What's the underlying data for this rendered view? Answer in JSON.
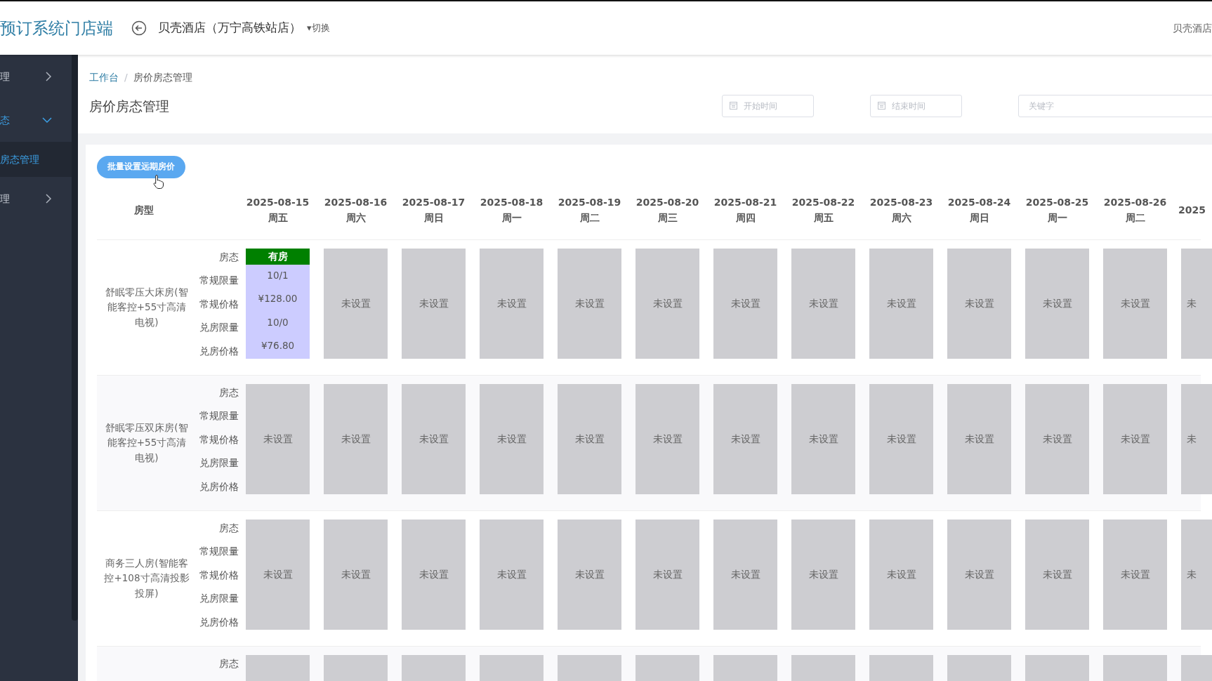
{
  "topbar": {
    "app_title": "预订系统门店端",
    "hotel_name": "贝壳酒店（万宁高铁站店）",
    "switch_label": "▾切换",
    "user": "贝壳酒店"
  },
  "sidebar": {
    "items": [
      {
        "label": "理",
        "expanded": false
      },
      {
        "label": "态",
        "expanded": true,
        "children": [
          {
            "label": "房态管理",
            "selected": true
          }
        ]
      },
      {
        "label": "理",
        "expanded": false
      }
    ]
  },
  "breadcrumb": [
    {
      "label": "工作台",
      "kind": "link"
    },
    {
      "label": "/",
      "kind": "separator"
    },
    {
      "label": "房价房态管理",
      "kind": "current"
    }
  ],
  "page_title": "房价房态管理",
  "filters": [
    {
      "placeholder": "开始时间",
      "kind": "date"
    },
    {
      "placeholder": "结束时间",
      "kind": "date"
    },
    {
      "placeholder": "关键字",
      "kind": "text"
    }
  ],
  "batch_button": "批量设置远期房价",
  "table": {
    "room_header": "房型",
    "dates": [
      {
        "date": "2025-08-15",
        "weekday": "周五"
      },
      {
        "date": "2025-08-16",
        "weekday": "周六"
      },
      {
        "date": "2025-08-17",
        "weekday": "周日"
      },
      {
        "date": "2025-08-18",
        "weekday": "周一"
      },
      {
        "date": "2025-08-19",
        "weekday": "周二"
      },
      {
        "date": "2025-08-20",
        "weekday": "周三"
      },
      {
        "date": "2025-08-21",
        "weekday": "周四"
      },
      {
        "date": "2025-08-22",
        "weekday": "周五"
      },
      {
        "date": "2025-08-23",
        "weekday": "周六"
      },
      {
        "date": "2025-08-24",
        "weekday": "周日"
      },
      {
        "date": "2025-08-25",
        "weekday": "周一"
      },
      {
        "date": "2025-08-26",
        "weekday": "周二"
      },
      {
        "date": "2025"
      }
    ],
    "rows": [
      {
        "room": "舒眠零压大床房(智能客控+55寸高清电视)",
        "labels": [
          "房态",
          "常规限量",
          "常规价格",
          "兑房限量",
          "兑房价格"
        ],
        "cells": [
          {
            "kind": "set",
            "status": "有房",
            "values": [
              "10/1",
              "¥128.00",
              "10/0",
              "¥76.80"
            ]
          },
          {
            "kind": "unset",
            "text": "未设置"
          },
          {
            "kind": "unset",
            "text": "未设置"
          },
          {
            "kind": "unset",
            "text": "未设置"
          },
          {
            "kind": "unset",
            "text": "未设置"
          },
          {
            "kind": "unset",
            "text": "未设置"
          },
          {
            "kind": "unset",
            "text": "未设置"
          },
          {
            "kind": "unset",
            "text": "未设置"
          },
          {
            "kind": "unset",
            "text": "未设置"
          },
          {
            "kind": "unset",
            "text": "未设置"
          },
          {
            "kind": "unset",
            "text": "未设置"
          },
          {
            "kind": "unset",
            "text": "未设置"
          },
          {
            "kind": "unset",
            "text": "未"
          }
        ]
      },
      {
        "room": "舒眠零压双床房(智能客控+55寸高清电视)",
        "labels": [
          "房态",
          "常规限量",
          "常规价格",
          "兑房限量",
          "兑房价格"
        ],
        "cells": [
          {
            "kind": "unset",
            "text": "未设置"
          },
          {
            "kind": "unset",
            "text": "未设置"
          },
          {
            "kind": "unset",
            "text": "未设置"
          },
          {
            "kind": "unset",
            "text": "未设置"
          },
          {
            "kind": "unset",
            "text": "未设置"
          },
          {
            "kind": "unset",
            "text": "未设置"
          },
          {
            "kind": "unset",
            "text": "未设置"
          },
          {
            "kind": "unset",
            "text": "未设置"
          },
          {
            "kind": "unset",
            "text": "未设置"
          },
          {
            "kind": "unset",
            "text": "未设置"
          },
          {
            "kind": "unset",
            "text": "未设置"
          },
          {
            "kind": "unset",
            "text": "未设置"
          },
          {
            "kind": "unset",
            "text": "未"
          }
        ]
      },
      {
        "room": "商务三人房(智能客控+108寸高清投影投屏)",
        "labels": [
          "房态",
          "常规限量",
          "常规价格",
          "兑房限量",
          "兑房价格"
        ],
        "cells": [
          {
            "kind": "unset",
            "text": "未设置"
          },
          {
            "kind": "unset",
            "text": "未设置"
          },
          {
            "kind": "unset",
            "text": "未设置"
          },
          {
            "kind": "unset",
            "text": "未设置"
          },
          {
            "kind": "unset",
            "text": "未设置"
          },
          {
            "kind": "unset",
            "text": "未设置"
          },
          {
            "kind": "unset",
            "text": "未设置"
          },
          {
            "kind": "unset",
            "text": "未设置"
          },
          {
            "kind": "unset",
            "text": "未设置"
          },
          {
            "kind": "unset",
            "text": "未设置"
          },
          {
            "kind": "unset",
            "text": "未设置"
          },
          {
            "kind": "unset",
            "text": "未设置"
          },
          {
            "kind": "unset",
            "text": "未"
          }
        ]
      },
      {
        "labels": [
          "房态"
        ],
        "cells": [
          {
            "kind": "blank"
          },
          {
            "kind": "blank"
          },
          {
            "kind": "blank"
          },
          {
            "kind": "blank"
          },
          {
            "kind": "blank"
          },
          {
            "kind": "blank"
          },
          {
            "kind": "blank"
          },
          {
            "kind": "blank"
          },
          {
            "kind": "blank"
          },
          {
            "kind": "blank"
          },
          {
            "kind": "blank"
          },
          {
            "kind": "blank"
          },
          {
            "kind": "blank"
          }
        ]
      }
    ]
  }
}
